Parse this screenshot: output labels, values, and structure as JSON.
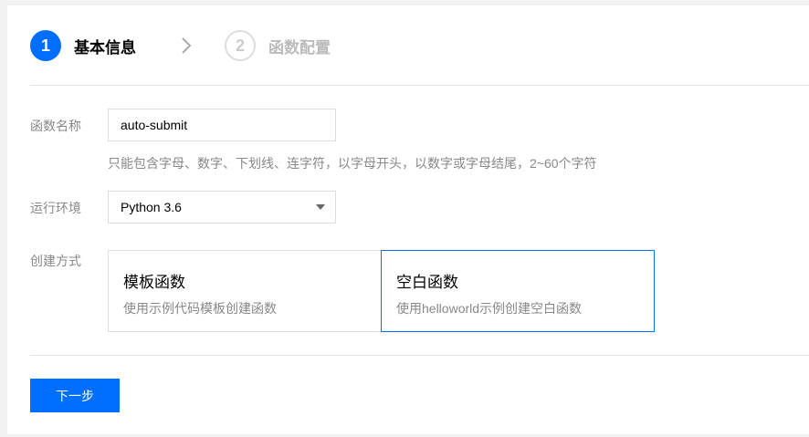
{
  "steps": [
    {
      "number": "1",
      "label": "基本信息",
      "active": true
    },
    {
      "number": "2",
      "label": "函数配置",
      "active": false
    }
  ],
  "form": {
    "name": {
      "label": "函数名称",
      "value": "auto-submit",
      "hint": "只能包含字母、数字、下划线、连字符，以字母开头，以数字或字母结尾，2~60个字符"
    },
    "runtime": {
      "label": "运行环境",
      "value": "Python 3.6"
    },
    "create_method": {
      "label": "创建方式",
      "options": [
        {
          "title": "模板函数",
          "desc": "使用示例代码模板创建函数",
          "selected": false
        },
        {
          "title": "空白函数",
          "desc": "使用helloworld示例创建空白函数",
          "selected": true
        }
      ]
    }
  },
  "next_button": "下一步",
  "colors": {
    "accent": "#006eff",
    "muted": "#888888",
    "border": "#dddddd"
  }
}
